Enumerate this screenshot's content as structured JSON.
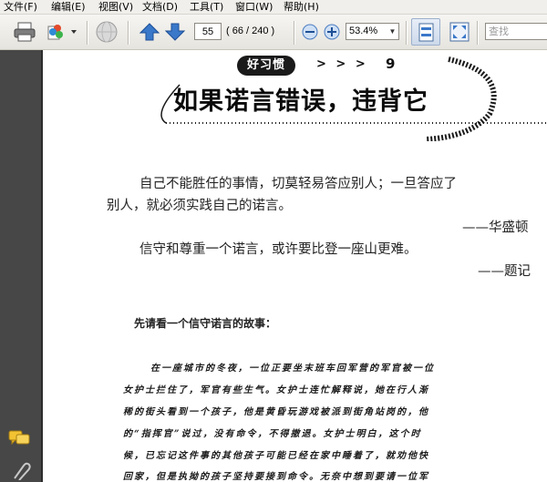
{
  "menu": [
    "文件(F)",
    "编辑(E)",
    "视图(V)",
    "文档(D)",
    "工具(T)",
    "窗口(W)",
    "帮助(H)"
  ],
  "toolbar": {
    "page_number": "55",
    "page_count": "( 66 / 240 )",
    "zoom": "53.4%",
    "search_placeholder": "查找",
    "icons": [
      "print-icon",
      "printer-settings-icon",
      "globe-icon",
      "previous-page-icon",
      "next-page-icon",
      "zoom-out-icon",
      "zoom-in-icon",
      "fit-page-icon",
      "fit-width-icon"
    ]
  },
  "sidebar": {
    "icons": [
      "comments-icon",
      "attachments-icon"
    ]
  },
  "document": {
    "header_badge": "好习惯",
    "header_arrows": "> > >",
    "header_number": "9",
    "title": "如果诺言错误，违背它",
    "quote1_line1": "自己不能胜任的事情，切莫轻易答应别人；一旦答应了",
    "quote1_line2": "别人，就必须实践自己的诺言。",
    "quote1_attr": "——华盛顿",
    "quote2_line1": "信守和尊重一个诺言，或许要比登一座山更难。",
    "quote2_attr": "——题记",
    "intro": "先请看一个信守诺言的故事：",
    "story_lines": [
      "在一座城市的冬夜，一位正要坐末班车回军营的军官被一位",
      "女护士拦住了，军官有些生气。女护士连忙解释说，她在行人渐",
      "稀的街头看到一个孩子，他是黄昏玩游戏被派到街角站岗的，他",
      "的“指挥官”说过，没有命令，不得撤退。女护士明白，这个时",
      "候，已忘记这件事的其他孩子可能已经在家中睡着了，就劝他快",
      "回家，但是执拗的孩子坚持要接到命令。无奈中想到要请一位军"
    ]
  }
}
